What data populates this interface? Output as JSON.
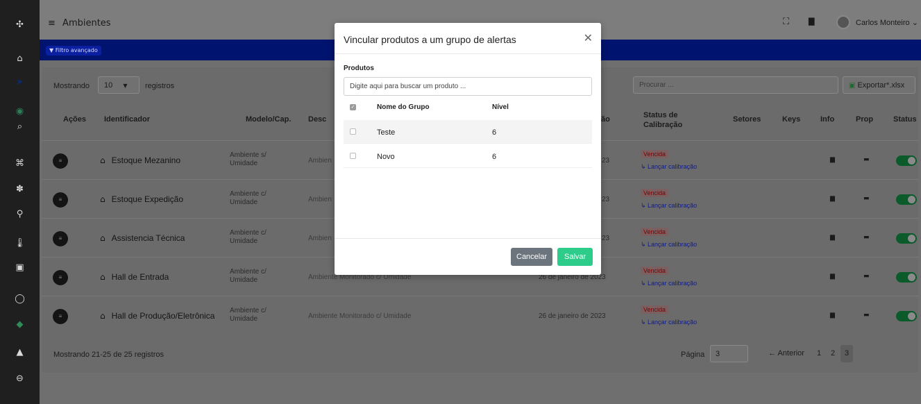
{
  "sidebar": {
    "icons": [
      "logo-icon",
      "home-icon",
      "send-icon",
      "target-icon",
      "clipboard-search-icon",
      "command-icon",
      "settings-icon",
      "network-icon",
      "thermometer-icon",
      "chip-icon",
      "circle-icon",
      "diamond-icon",
      "warning-icon",
      "user-circle-icon"
    ],
    "glyphs": [
      "✣",
      "⌂",
      "➤",
      "◉",
      "⌕",
      "⌘",
      "✽",
      "⚲",
      "🌡",
      "▣",
      "◯",
      "◆",
      "▲",
      "⊖"
    ]
  },
  "header": {
    "menu_glyph": "≡",
    "title": "Ambientes",
    "fullscreen_glyph": "⛶",
    "book_glyph": "▇",
    "user_name": "Carlos Monteiro ⌄"
  },
  "filter": {
    "label": "▼ Filtro avançado"
  },
  "controls": {
    "show_label": "Mostrando",
    "page_size": "10",
    "records_label": "registros",
    "search_placeholder": "Procurar ...",
    "export_label": "Exportar*.xlsx"
  },
  "columns": {
    "acoes": "Ações",
    "identificador": "Identificador",
    "modelo": "Modelo/Cap.",
    "descricao": "Desc",
    "calibracao_date": "ão",
    "status_calib": "Status de Calibração",
    "setores": "Setores",
    "keys": "Keys",
    "info": "Info",
    "prop": "Prop",
    "status": "Status"
  },
  "rows": [
    {
      "name": "Estoque Mezanino",
      "modelo": "Ambiente s/ Umidade",
      "descricao": "Ambien",
      "date": "23",
      "status": "Vencida",
      "action": "↳ Lançar calibração"
    },
    {
      "name": "Estoque Expedição",
      "modelo": "Ambiente c/ Umidade",
      "descricao": "Ambien",
      "date": "23",
      "status": "Vencida",
      "action": "↳ Lançar calibração"
    },
    {
      "name": "Assistencia Técnica",
      "modelo": "Ambiente c/ Umidade",
      "descricao": "Ambien",
      "date": "23",
      "status": "Vencida",
      "action": "↳ Lançar calibração"
    },
    {
      "name": "Hall de Entrada",
      "modelo": "Ambiente c/ Umidade",
      "descricao": "Ambiente Monitorado c/ Umidade",
      "date": "26 de janeiro de 2023",
      "status": "Vencida",
      "action": "↳ Lançar calibração"
    },
    {
      "name": "Hall de Produção/Eletrônica",
      "modelo": "Ambiente c/ Umidade",
      "descricao": "Ambiente Monitorado c/ Umidade",
      "date": "26 de janeiro de 2023",
      "status": "Vencida",
      "action": "↳ Lançar calibração"
    }
  ],
  "footer": {
    "summary": "Mostrando 21-25 de 25 registros",
    "page_label": "Página",
    "page_value": "3",
    "prev": "← Anterior",
    "pages": [
      "1",
      "2",
      "3"
    ]
  },
  "modal": {
    "title": "Vincular produtos a um grupo de alertas",
    "close": "✕",
    "products_label": "Produtos",
    "search_placeholder": "Digite aqui para buscar um produto ...",
    "col_name": "Nome do Grupo",
    "col_level": "Nível",
    "groups": [
      {
        "name": "Teste",
        "level": "6"
      },
      {
        "name": "Novo",
        "level": "6"
      }
    ],
    "cancel": "Cancelar",
    "save": "Salvar"
  },
  "colors": {
    "accent_blue": "#00136e",
    "save_green": "#2ecc8a",
    "toggle_on": "#0a5a2a"
  }
}
